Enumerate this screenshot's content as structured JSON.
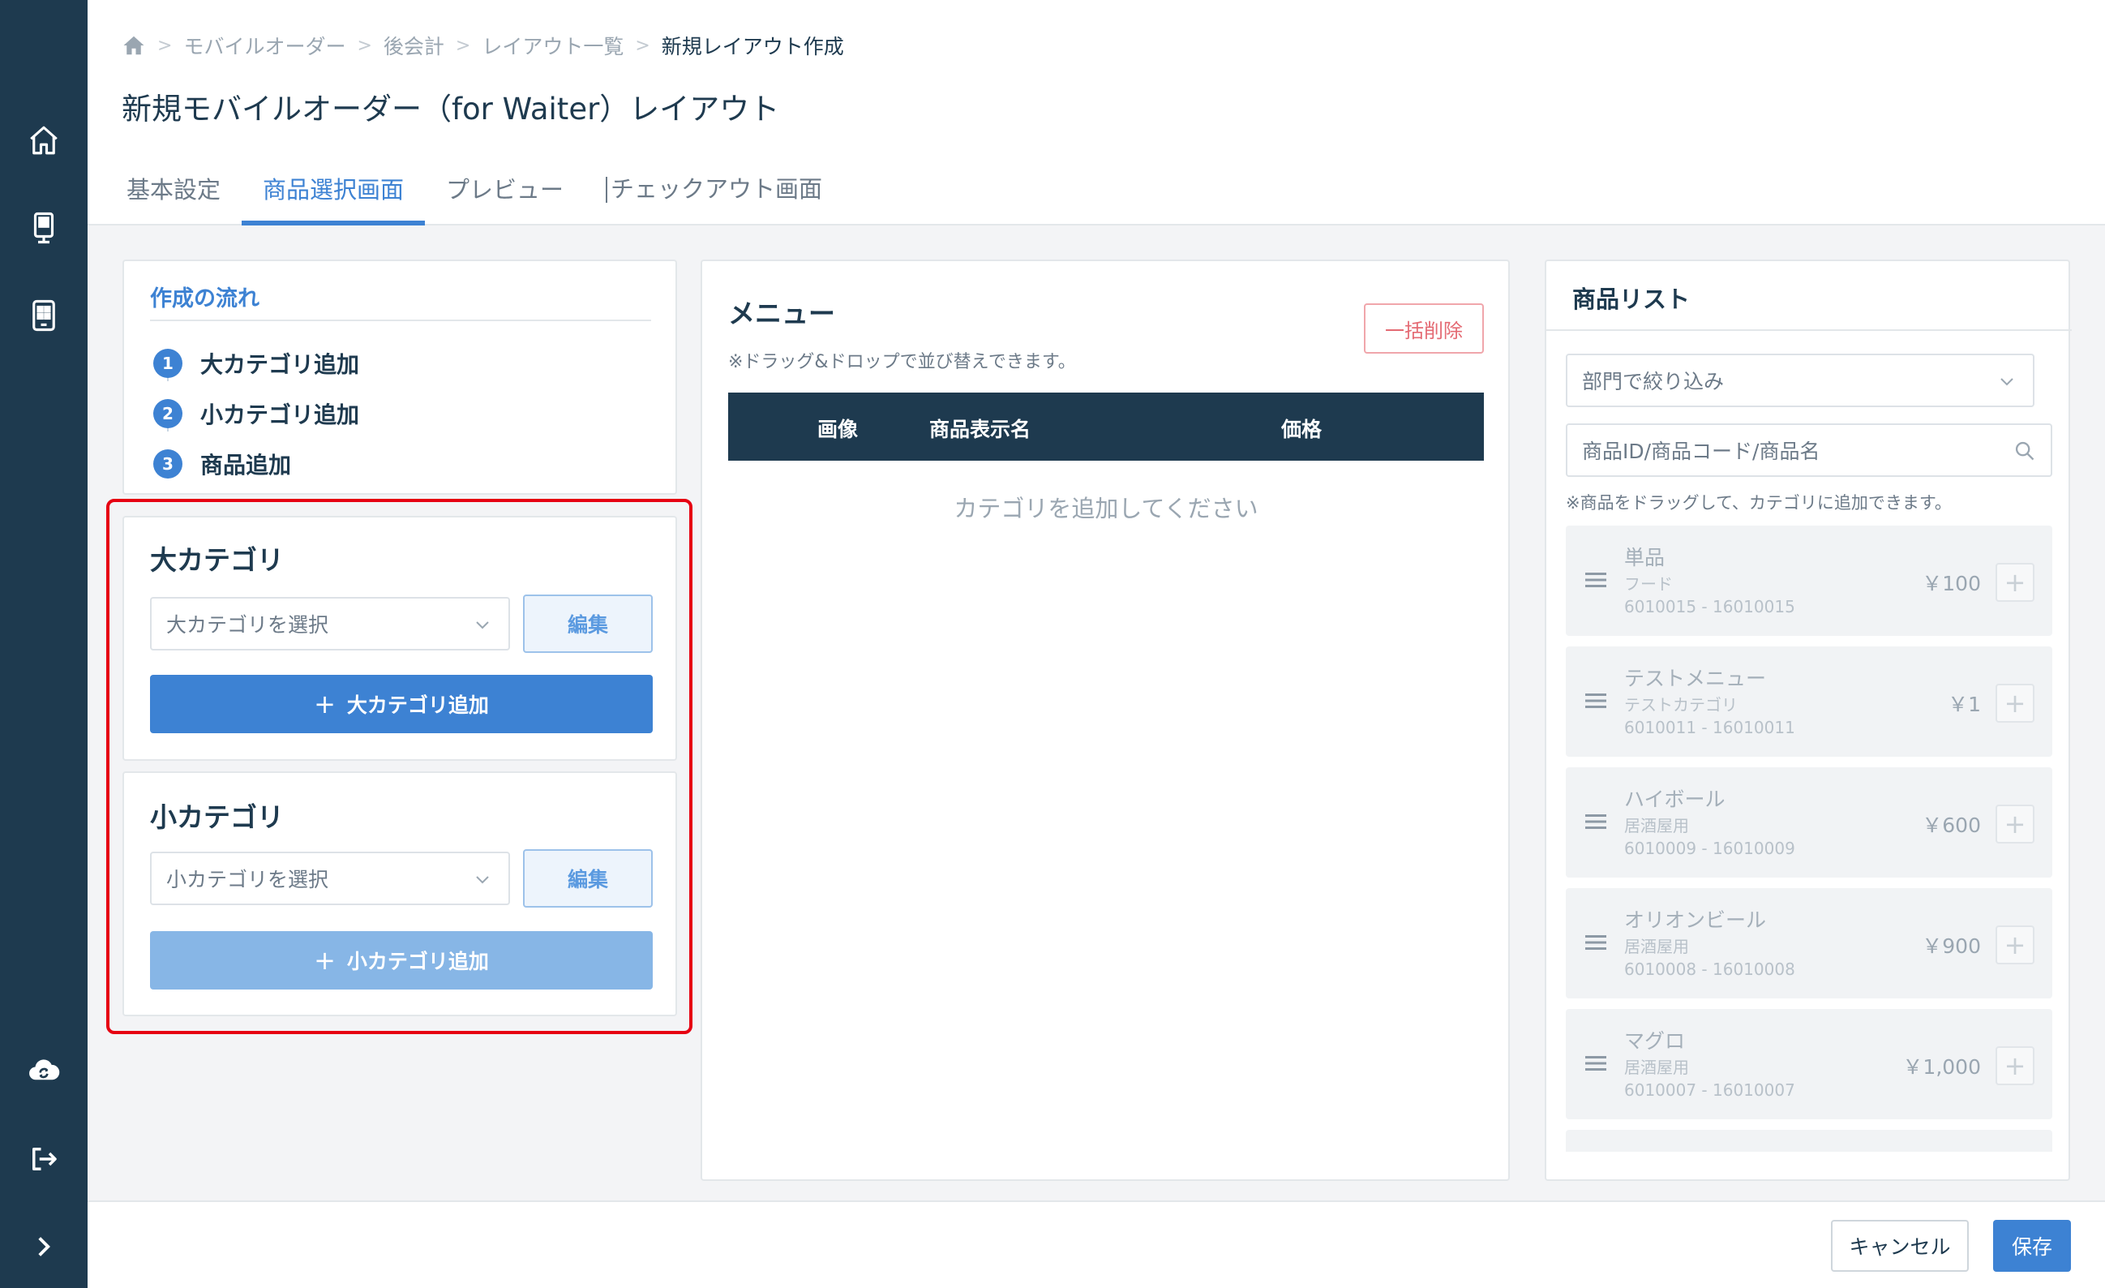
{
  "breadcrumb": {
    "items": [
      "モバイルオーダー",
      "後会計",
      "レイアウト一覧"
    ],
    "current": "新規レイアウト作成"
  },
  "page_title": "新規モバイルオーダー（for Waiter）レイアウト",
  "tabs": [
    "基本設定",
    "商品選択画面",
    "プレビュー",
    "チェックアウト画面"
  ],
  "active_tab": "商品選択画面",
  "flow": {
    "title": "作成の流れ",
    "steps": [
      {
        "num": "1",
        "label": "大カテゴリ追加"
      },
      {
        "num": "2",
        "label": "小カテゴリ追加"
      },
      {
        "num": "3",
        "label": "商品追加"
      }
    ]
  },
  "major_category": {
    "title": "大カテゴリ",
    "placeholder": "大カテゴリを選択",
    "edit_label": "編集",
    "add_label": "大カテゴリ追加"
  },
  "minor_category": {
    "title": "小カテゴリ",
    "placeholder": "小カテゴリを選択",
    "edit_label": "編集",
    "add_label": "小カテゴリ追加"
  },
  "menu": {
    "title": "メニュー",
    "bulk_delete_label": "一括削除",
    "note": "※ドラッグ&ドロップで並び替えできます。",
    "columns": [
      "画像",
      "商品表示名",
      "価格"
    ],
    "empty_message": "カテゴリを追加してください"
  },
  "product_list": {
    "title": "商品リスト",
    "department_filter": "部門で絞り込み",
    "search_placeholder": "商品ID/商品コード/商品名",
    "note": "※商品をドラッグして、カテゴリに追加できます。",
    "items": [
      {
        "name": "単品",
        "category": "フード",
        "code": "6010015 - 16010015",
        "price": "￥100"
      },
      {
        "name": "テストメニュー",
        "category": "テストカテゴリ",
        "code": "6010011 - 16010011",
        "price": "￥1"
      },
      {
        "name": "ハイボール",
        "category": "居酒屋用",
        "code": "6010009 - 16010009",
        "price": "￥600"
      },
      {
        "name": "オリオンビール",
        "category": "居酒屋用",
        "code": "6010008 - 16010008",
        "price": "￥900"
      },
      {
        "name": "マグロ",
        "category": "居酒屋用",
        "code": "6010007 - 16010007",
        "price": "￥1,000"
      }
    ]
  },
  "footer": {
    "cancel_label": "キャンセル",
    "save_label": "保存"
  },
  "colors": {
    "sidebar": "#1e3a4f",
    "accent": "#3d82d3",
    "highlight_frame": "#e60012",
    "danger": "#e46a73"
  },
  "icons": {
    "sidebar": [
      "home-icon",
      "tablet-order-icon",
      "mobile-order-icon",
      "cloud-sync-icon",
      "logout-icon",
      "chevron-right-icon"
    ]
  }
}
